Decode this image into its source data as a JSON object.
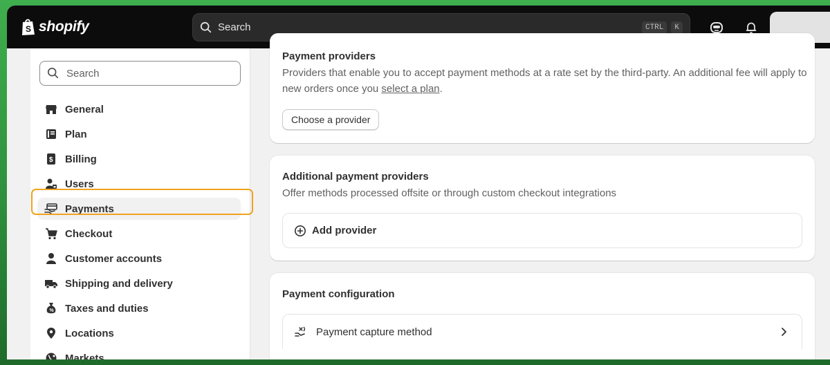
{
  "topbar": {
    "brand": "shopify",
    "search_placeholder": "Search",
    "shortcut_key1": "CTRL",
    "shortcut_key2": "K"
  },
  "sidebar": {
    "search_placeholder": "Search",
    "items": [
      {
        "label": "General",
        "icon": "store-icon"
      },
      {
        "label": "Plan",
        "icon": "plan-icon"
      },
      {
        "label": "Billing",
        "icon": "receipt-icon"
      },
      {
        "label": "Users",
        "icon": "users-icon"
      },
      {
        "label": "Payments",
        "icon": "payments-icon",
        "active": true
      },
      {
        "label": "Checkout",
        "icon": "cart-icon"
      },
      {
        "label": "Customer accounts",
        "icon": "person-icon"
      },
      {
        "label": "Shipping and delivery",
        "icon": "truck-icon"
      },
      {
        "label": "Taxes and duties",
        "icon": "tax-icon"
      },
      {
        "label": "Locations",
        "icon": "location-icon"
      },
      {
        "label": "Markets",
        "icon": "globe-icon"
      }
    ]
  },
  "main": {
    "providers": {
      "title": "Payment providers",
      "description_1": "Providers that enable you to accept payment methods at a rate set by the third-party. An additional fee will apply to new orders once you ",
      "link": "select a plan",
      "description_2": ".",
      "button": "Choose a provider"
    },
    "additional": {
      "title": "Additional payment providers",
      "description": "Offer methods processed offsite or through custom checkout integrations",
      "add_label": "Add provider"
    },
    "configuration": {
      "title": "Payment configuration",
      "capture_label": "Payment capture method"
    }
  },
  "colors": {
    "accent_highlight": "#f0a21e",
    "topbar": "#0c0c0c",
    "background": "#f1f1f1"
  }
}
